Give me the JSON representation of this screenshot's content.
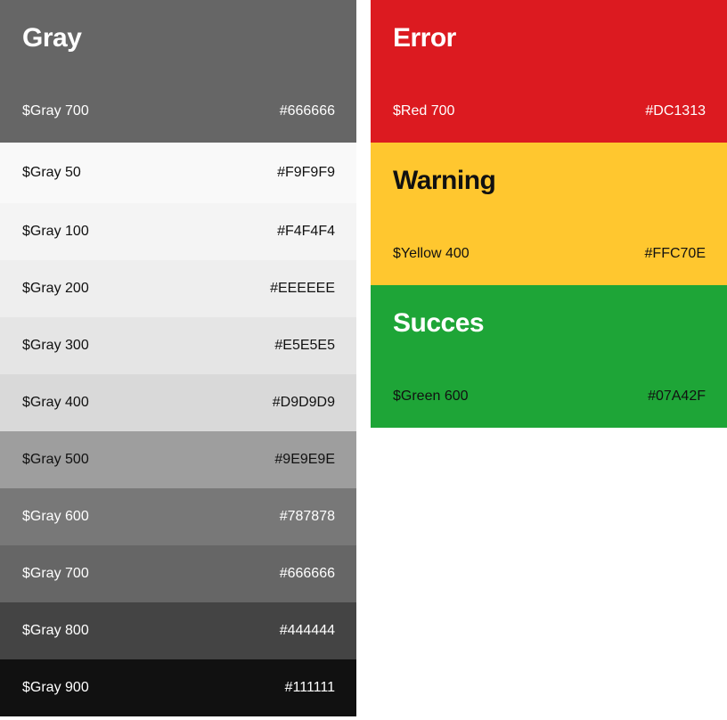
{
  "gray": {
    "title": "Gray",
    "main": {
      "name": "$Gray 700",
      "hex": "#666666",
      "color": "#666666"
    },
    "shades": [
      {
        "name": "$Gray 50",
        "hex": "#F9F9F9",
        "color": "#F9F9F9",
        "text": "dark"
      },
      {
        "name": "$Gray 100",
        "hex": "#F4F4F4",
        "color": "#F4F4F4",
        "text": "dark"
      },
      {
        "name": "$Gray 200",
        "hex": "#EEEEEE",
        "color": "#EEEEEE",
        "text": "dark"
      },
      {
        "name": "$Gray 300",
        "hex": "#E5E5E5",
        "color": "#E5E5E5",
        "text": "dark"
      },
      {
        "name": "$Gray 400",
        "hex": "#D9D9D9",
        "color": "#D9D9D9",
        "text": "dark"
      },
      {
        "name": "$Gray 500",
        "hex": "#9E9E9E",
        "color": "#9E9E9E",
        "text": "dark"
      },
      {
        "name": "$Gray 600",
        "hex": "#787878",
        "color": "#787878",
        "text": "light"
      },
      {
        "name": "$Gray 700",
        "hex": "#666666",
        "color": "#666666",
        "text": "light"
      },
      {
        "name": "$Gray 800",
        "hex": "#444444",
        "color": "#444444",
        "text": "light"
      },
      {
        "name": "$Gray 900",
        "hex": "#111111",
        "color": "#111111",
        "text": "light"
      }
    ]
  },
  "error": {
    "title": "Error",
    "name": "$Red 700",
    "hex": "#DC1313",
    "color": "#DC1A20"
  },
  "warning": {
    "title": "Warning",
    "name": "$Yellow 400",
    "hex": "#FFC70E",
    "color": "#FFC72F"
  },
  "success": {
    "title": "Succes",
    "name": "$Green 600",
    "hex": "#07A42F",
    "color": "#1EA537"
  }
}
